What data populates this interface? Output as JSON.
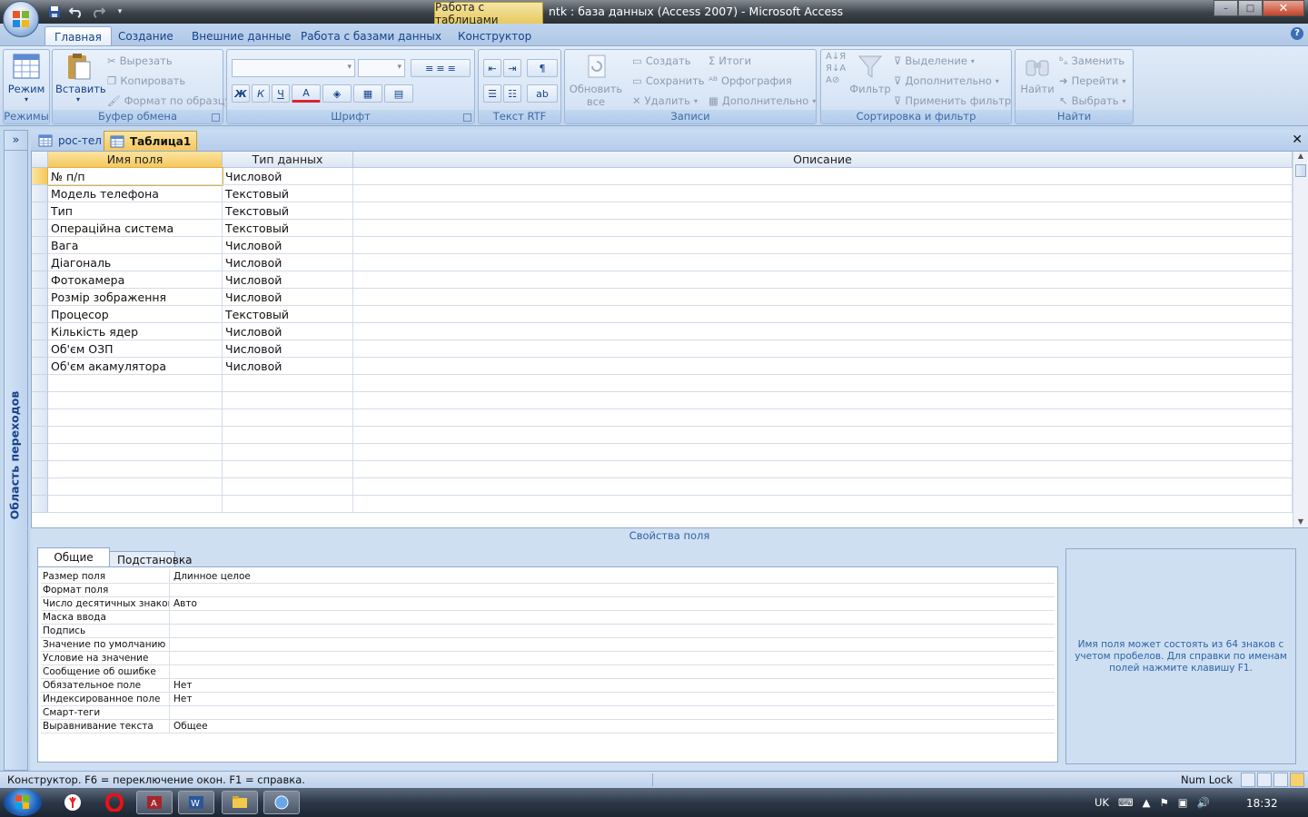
{
  "window": {
    "title": "ntk : база данных (Access 2007) - Microsoft Access",
    "context_tab": "Работа с таблицами",
    "min": "–",
    "max": "□",
    "close": "✕"
  },
  "ribbon_tabs": [
    "Главная",
    "Создание",
    "Внешние данные",
    "Работа с базами данных",
    "Конструктор"
  ],
  "ribbon": {
    "views": {
      "label": "Режим",
      "caption": "Режимы"
    },
    "clipboard": {
      "paste": "Вставить",
      "cut": "Вырезать",
      "copy": "Копировать",
      "format_painter": "Формат по образцу",
      "caption": "Буфер обмена"
    },
    "font": {
      "bold": "Ж",
      "italic": "К",
      "underline": "Ч",
      "font_color": "A",
      "caption": "Шрифт"
    },
    "rtf": {
      "caption": "Текст RTF"
    },
    "records": {
      "refresh": "Обновить",
      "refresh2": "все",
      "new": "Создать",
      "save": "Сохранить",
      "delete": "Удалить",
      "totals": "Итоги",
      "spelling": "Орфография",
      "more": "Дополнительно",
      "caption": "Записи"
    },
    "sort": {
      "filter": "Фильтр",
      "selection": "Выделение",
      "advanced": "Дополнительно",
      "toggle": "Применить фильтр",
      "caption": "Сортировка и фильтр"
    },
    "find": {
      "find": "Найти",
      "replace": "Заменить",
      "goto": "Перейти",
      "select": "Выбрать",
      "caption": "Найти"
    }
  },
  "nav_pane": {
    "label": "Область переходов",
    "toggle": "»"
  },
  "doc_tabs": [
    "рос-тел",
    "Таблица1"
  ],
  "grid": {
    "headers": [
      "Имя поля",
      "Тип данных",
      "Описание"
    ],
    "rows": [
      {
        "name": "№ п/п",
        "type": "Числовой"
      },
      {
        "name": "Модель телефона",
        "type": "Текстовый"
      },
      {
        "name": "Тип",
        "type": "Текстовый"
      },
      {
        "name": "Операційна система",
        "type": "Текстовый"
      },
      {
        "name": "Вага",
        "type": "Числовой"
      },
      {
        "name": "Діагональ",
        "type": "Числовой"
      },
      {
        "name": "Фотокамера",
        "type": "Числовой"
      },
      {
        "name": "Розмір зображення",
        "type": "Числовой"
      },
      {
        "name": "Процесор",
        "type": "Текстовый"
      },
      {
        "name": "Кількість ядер",
        "type": "Числовой"
      },
      {
        "name": "Об'єм ОЗП",
        "type": "Числовой"
      },
      {
        "name": "Об'єм акамулятора",
        "type": "Числовой"
      }
    ]
  },
  "properties": {
    "title": "Свойства поля",
    "tabs": [
      "Общие",
      "Подстановка"
    ],
    "rows": [
      {
        "k": "Размер поля",
        "v": "Длинное целое"
      },
      {
        "k": "Формат поля",
        "v": ""
      },
      {
        "k": "Число десятичных знаков",
        "v": "Авто"
      },
      {
        "k": "Маска ввода",
        "v": ""
      },
      {
        "k": "Подпись",
        "v": ""
      },
      {
        "k": "Значение по умолчанию",
        "v": ""
      },
      {
        "k": "Условие на значение",
        "v": ""
      },
      {
        "k": "Сообщение об ошибке",
        "v": ""
      },
      {
        "k": "Обязательное поле",
        "v": "Нет"
      },
      {
        "k": "Индексированное поле",
        "v": "Нет"
      },
      {
        "k": "Смарт-теги",
        "v": ""
      },
      {
        "k": "Выравнивание текста",
        "v": "Общее"
      }
    ],
    "help": "Имя поля может состоять из 64 знаков с учетом пробелов.  Для справки по именам полей нажмите клавишу F1."
  },
  "status": {
    "text": "Конструктор.  F6 = переключение окон.  F1 = справка.",
    "numlock": "Num Lock"
  },
  "taskbar": {
    "lang": "UK",
    "clock": "18:32"
  }
}
